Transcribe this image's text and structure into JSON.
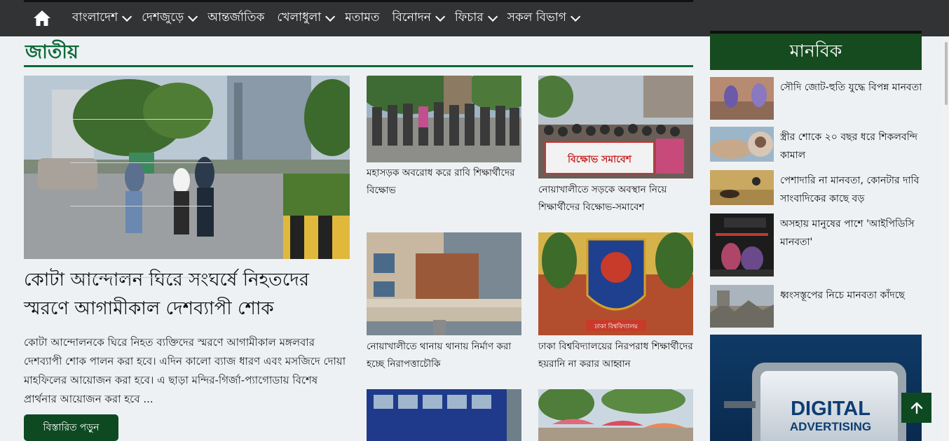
{
  "nav": {
    "home_icon": "home-icon",
    "items": [
      {
        "label": "বাংলাদেশ",
        "dropdown": true
      },
      {
        "label": "দেশজুড়ে",
        "dropdown": true
      },
      {
        "label": "আন্তর্জাতিক",
        "dropdown": false
      },
      {
        "label": "খেলাধুলা",
        "dropdown": true
      },
      {
        "label": "মতামত",
        "dropdown": false
      },
      {
        "label": "বিনোদন",
        "dropdown": true
      },
      {
        "label": "ফিচার",
        "dropdown": true
      },
      {
        "label": "সকল বিভাগ",
        "dropdown": true
      }
    ]
  },
  "section": {
    "title": "জাতীয়",
    "accent_color": "#0a6b39"
  },
  "lead": {
    "title": "কোটা আন্দোলন ঘিরে সংঘর্ষে নিহতদের স্মরণে আগামীকাল দেশব্যাপী শোক",
    "summary": "কোটা আন্দোলনকে ঘিরে নিহত ব্যক্তিদের স্মরণে আগামীকাল মঙ্গলবার দেশব্যাপী শোক পালন করা হবে। এদিন কালো ব্যাজ ধারণ এবং মসজিদে দোয়া মাহফিলের আয়োজন করা হবে। এ ছাড়া মন্দির-গির্জা-প্যাগোডায় বিশেষ প্রার্থনার আয়োজন করা হবে ...",
    "read_more": "বিস্তারিত পড়ুন"
  },
  "cards": [
    {
      "title": "মহাসড়ক অবরোধ করে রাবি শিক্ষার্থীদের বিক্ষোভ"
    },
    {
      "title": "নোয়াখালীতে সড়কে অবস্থান নিয়ে শিক্ষার্থীদের বিক্ষোভ-সমাবেশ",
      "banner": "বিক্ষোভ সমাবেশ"
    },
    {
      "title": "নোয়াখালীতে থানায় থানায় নির্মাণ করা হচ্ছে নিরাপত্তাচৌকি"
    },
    {
      "title": "ঢাকা বিশ্ববিদ্যালয়ের নিরপরাধ শিক্ষার্থীদের হয়রানি না করার আহ্বান",
      "logo_text": "ঢাকা বিশ্ববিদ্যালয়"
    },
    {
      "title": ""
    },
    {
      "title": ""
    }
  ],
  "sidebar": {
    "title": "মানবিক",
    "items": [
      {
        "title": "সৌদি জোট-হুতি যুদ্ধে বিপন্ন মানবতা"
      },
      {
        "title": "স্ত্রীর শোকে ২০ বছর ধরে শিকলবন্দি কামাল"
      },
      {
        "title": "পেশাদারি না মানবতা, কোনটার দাবি সাংবাদিকের কাছে বড়"
      },
      {
        "title": "অসহায় মানুষের পাশে 'আইপিডিসি মানবতা'"
      },
      {
        "title": "ধ্বংসস্তূপের নিচে মানবতা কাঁদছে"
      }
    ],
    "ad": {
      "line1": "DIGITAL",
      "line2": "ADVERTISING"
    }
  },
  "scroll_top_icon": "arrow-up-icon",
  "colors": {
    "nav_bg": "#323335",
    "brand_green": "#0d4a22",
    "sidebar_head": "#164a1f"
  }
}
